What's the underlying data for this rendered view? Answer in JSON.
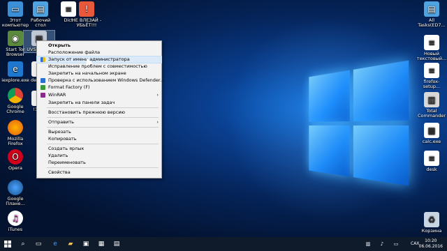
{
  "desktop": {
    "icons_left": [
      {
        "label": "Этот компьютер",
        "icon": "computer-icon"
      },
      {
        "label": "Start Tor Browser",
        "icon": "tor-icon"
      },
      {
        "label": "iexplore.exe",
        "icon": "ie-icon"
      },
      {
        "label": "Google Chrome",
        "icon": "chrome-icon"
      },
      {
        "label": "Mozilla Firefox",
        "icon": "firefox-icon"
      },
      {
        "label": "Opera",
        "icon": "opera-icon"
      },
      {
        "label": "Google Планe...",
        "icon": "earth-icon"
      },
      {
        "label": "iTunes",
        "icon": "itunes-icon"
      }
    ],
    "icons_col2": [
      {
        "label": "Рабочий стол",
        "icon": "folder-icon"
      },
      {
        "label": "UVSc... me",
        "icon": "uvs-icon"
      },
      {
        "label": "deskt...",
        "icon": "file-icon"
      },
      {
        "label": "!1A...",
        "icon": "file-icon"
      }
    ],
    "icons_top": [
      {
        "label": "Dict",
        "icon": "document-icon"
      },
      {
        "label": "НЕ ВЛЕЗАЙ - УБЬЁТ!!!",
        "icon": "warning-icon"
      }
    ],
    "icons_right": [
      {
        "label": "All Tasks(ED7...",
        "icon": "folder-icon"
      },
      {
        "label": "Новый текстовый...",
        "icon": "document-icon"
      },
      {
        "label": "firefox-setup...",
        "icon": "document-icon"
      },
      {
        "label": "Total Commander",
        "icon": "tc-icon"
      },
      {
        "label": "calc.exe",
        "icon": "calc-icon"
      },
      {
        "label": "desk",
        "icon": "document-icon"
      },
      {
        "label": "Корзина",
        "icon": "recycle-bin-icon"
      }
    ]
  },
  "context_menu": {
    "items": [
      {
        "label": "Открыть",
        "bold": true
      },
      {
        "label": "Расположение файла"
      },
      {
        "label": "Запуск от имени администратора",
        "highlighted": true,
        "icon": "shield-icon"
      },
      {
        "label": "Исправление проблем с совместимостью"
      },
      {
        "label": "Закрепить на начальном экране"
      },
      {
        "label": "Проверка с использованием Windows Defender...",
        "icon": "defender-icon"
      },
      {
        "label": "Format Factory (F)",
        "icon": "ff-icon"
      },
      {
        "label": "WinRAR",
        "icon": "winrar-icon",
        "submenu": true
      },
      {
        "label": "Закрепить на панели задач"
      },
      {
        "label": "Восстановить прежнюю версию"
      },
      {
        "label": "Отправить",
        "submenu": true
      },
      {
        "label": "Вырезать"
      },
      {
        "label": "Копировать"
      },
      {
        "label": "Создать ярлык"
      },
      {
        "label": "Удалить"
      },
      {
        "label": "Переименовать"
      },
      {
        "label": "Свойства"
      }
    ]
  },
  "taskbar": {
    "lang": "CAX",
    "time": "10:20",
    "date": "06.06.2016"
  },
  "colors": {
    "accent": "#0a6ad6",
    "menu_bg": "#f2f2f2",
    "highlight": "#dbe9f8",
    "taskbar": "#0f1a2a"
  }
}
